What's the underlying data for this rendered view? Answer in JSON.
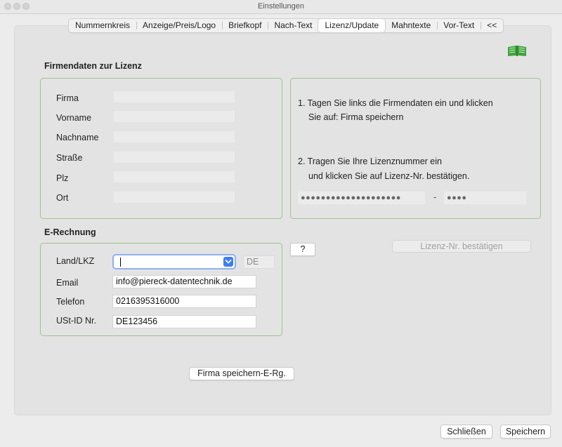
{
  "window": {
    "title": "Einstellungen"
  },
  "tabs": [
    {
      "label": "Nummernkreis",
      "active": false
    },
    {
      "label": "Anzeige/Preis/Logo",
      "active": false
    },
    {
      "label": "Briefkopf",
      "active": false
    },
    {
      "label": "Nach-Text",
      "active": false
    },
    {
      "label": "Lizenz/Update",
      "active": true
    },
    {
      "label": "Mahntexte",
      "active": false
    },
    {
      "label": "Vor-Text",
      "active": false
    },
    {
      "label": "<<",
      "active": false
    }
  ],
  "icons": {
    "manual": "book-icon",
    "dropdown": "chevron-down-icon"
  },
  "colors": {
    "box_border": "#9ec28f",
    "accent": "#3d7ef5",
    "book": "#3ea43a"
  },
  "license": {
    "section_title": "Firmendaten zur Lizenz",
    "fields": [
      {
        "label": "Firma",
        "value": ""
      },
      {
        "label": "Vorname",
        "value": ""
      },
      {
        "label": "Nachname",
        "value": ""
      },
      {
        "label": "Straße",
        "value": ""
      },
      {
        "label": "Plz",
        "value": ""
      },
      {
        "label": "Ort",
        "value": ""
      }
    ],
    "instructions": {
      "step1_line1": "1. Tagen Sie links die Firmendaten ein und klicken",
      "step1_line2": "Sie auf: Firma speichern",
      "step2_line1": "2. Tragen Sie Ihre Lizenznummer ein",
      "step2_line2": "und klicken Sie auf Lizenz-Nr. bestätigen."
    },
    "license_number": "●●●●●●●●●●●●●●●●●●●●",
    "separator": "-",
    "license_suffix": "●●●●",
    "confirm_button": "Lizenz-Nr. bestätigen"
  },
  "erechnung": {
    "section_title": "E-Rechnung",
    "help_button": "?",
    "land_label": "Land/LKZ",
    "land_value": "",
    "country_code": "DE",
    "email_label": "Email",
    "email_value": "info@piereck-datentechnik.de",
    "phone_label": "Telefon",
    "phone_value": "0216395316000",
    "vat_label": "USt-ID Nr.",
    "vat_value": "DE123456",
    "save_button": "Firma speichern-E-Rg."
  },
  "footer": {
    "close_button": "Schließen",
    "save_button": "Speichern"
  }
}
